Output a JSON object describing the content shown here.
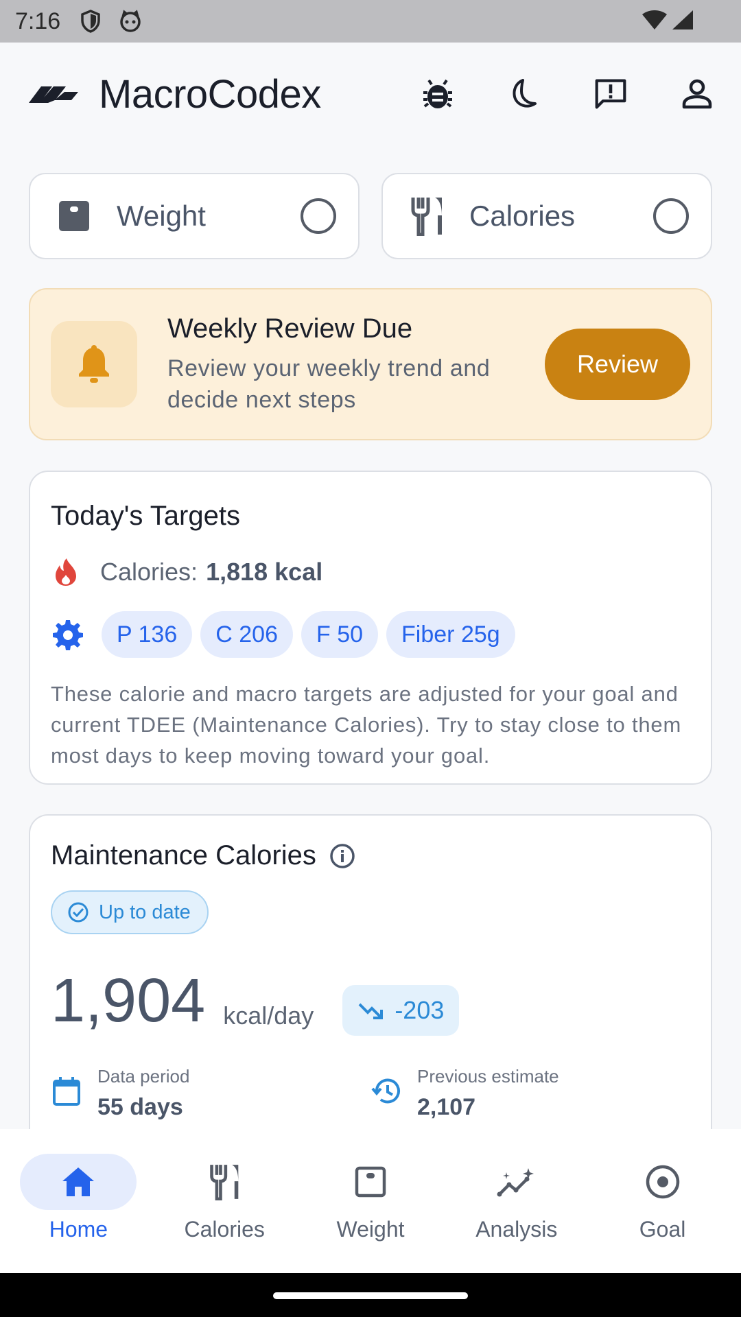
{
  "status_bar": {
    "time": "7:16"
  },
  "app": {
    "title": "MacroCodex"
  },
  "header_actions": [
    {
      "name": "bug-icon"
    },
    {
      "name": "moon-icon"
    },
    {
      "name": "feedback-icon"
    },
    {
      "name": "account-icon"
    }
  ],
  "quick_log": {
    "weight_label": "Weight",
    "calories_label": "Calories"
  },
  "weekly_review": {
    "title": "Weekly Review Due",
    "description": "Review your weekly trend and decide next steps",
    "button": "Review",
    "accent": "#c98212"
  },
  "targets": {
    "title": "Today's Targets",
    "calories_label": "Calories:",
    "calories_value": "1,818 kcal",
    "chips": [
      "P 136",
      "C 206",
      "F 50",
      "Fiber 25g"
    ],
    "description": "These calorie and macro targets are adjusted for your goal and current TDEE (Maintenance Calories). Try to stay close to them most days to keep moving toward your goal."
  },
  "maintenance": {
    "title": "Maintenance Calories",
    "status": "Up to date",
    "value": "1,904",
    "unit": "kcal/day",
    "delta": "-203",
    "data_period_label": "Data period",
    "data_period_value": "55 days",
    "previous_label": "Previous estimate",
    "previous_value": "2,107"
  },
  "bottom_nav": {
    "home": "Home",
    "calories": "Calories",
    "weight": "Weight",
    "analysis": "Analysis",
    "goal": "Goal"
  },
  "colors": {
    "primary": "#2563eb",
    "info": "#2b8ad6",
    "warning": "#c98212",
    "danger": "#e0463c"
  }
}
